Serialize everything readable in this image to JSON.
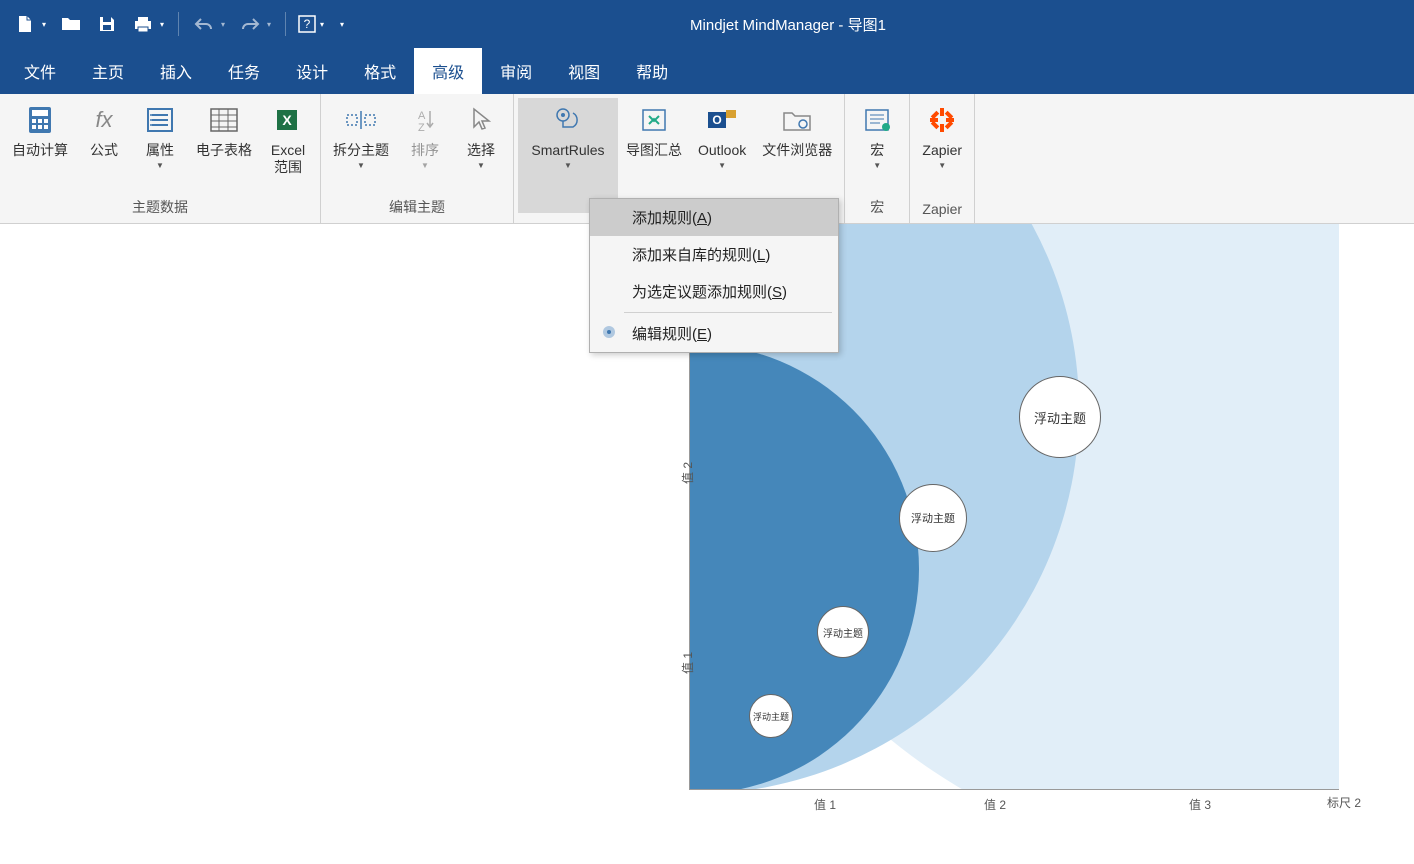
{
  "title": "Mindjet MindManager - 导图1",
  "menu": {
    "items": [
      "文件",
      "主页",
      "插入",
      "任务",
      "设计",
      "格式",
      "高级",
      "审阅",
      "视图",
      "帮助"
    ],
    "active": "高级"
  },
  "groups": [
    {
      "label": "主题数据",
      "buttons": [
        {
          "text": "自动计算",
          "arrow": false
        },
        {
          "text": "公式",
          "arrow": false
        },
        {
          "text": "属性",
          "arrow": true
        },
        {
          "text": "电子表格",
          "arrow": false
        },
        {
          "text": "Excel\n范围",
          "arrow": false
        }
      ]
    },
    {
      "label": "编辑主题",
      "buttons": [
        {
          "text": "拆分主题",
          "arrow": true
        },
        {
          "text": "排序",
          "arrow": true,
          "disabled": true
        },
        {
          "text": "选择",
          "arrow": true
        }
      ]
    },
    {
      "label": "",
      "buttons": [
        {
          "text": "SmartRules",
          "arrow": true,
          "active": true
        },
        {
          "text": "导图汇总",
          "arrow": false
        },
        {
          "text": "Outlook",
          "arrow": true
        },
        {
          "text": "文件浏览器",
          "arrow": false
        }
      ]
    },
    {
      "label": "宏",
      "buttons": [
        {
          "text": "宏",
          "arrow": true
        }
      ]
    },
    {
      "label": "Zapier",
      "buttons": [
        {
          "text": "Zapier",
          "arrow": true
        }
      ]
    }
  ],
  "dropdown": {
    "items": [
      {
        "pre": "添加规则(",
        "u": "A",
        "post": ")",
        "highlight": true
      },
      {
        "pre": "添加来自库的规则(",
        "u": "L",
        "post": ")"
      },
      {
        "pre": "为选定议题添加规则(",
        "u": "S",
        "post": ")"
      },
      {
        "sep": true
      },
      {
        "pre": "编辑规则(",
        "u": "E",
        "post": ")",
        "icon": true
      }
    ]
  },
  "chart_data": {
    "type": "bubble",
    "title": "",
    "xlabel": "标尺 2",
    "ylabel_ticks": [
      "值 1",
      "值 2"
    ],
    "xlabel_ticks": [
      "值 1",
      "值 2",
      "值 3"
    ],
    "bubbles": [
      {
        "label": "浮动主题",
        "ring": 1
      },
      {
        "label": "浮动主题",
        "ring": 1
      },
      {
        "label": "浮动主题",
        "ring": 2
      },
      {
        "label": "浮动主题",
        "ring": 3
      }
    ]
  }
}
